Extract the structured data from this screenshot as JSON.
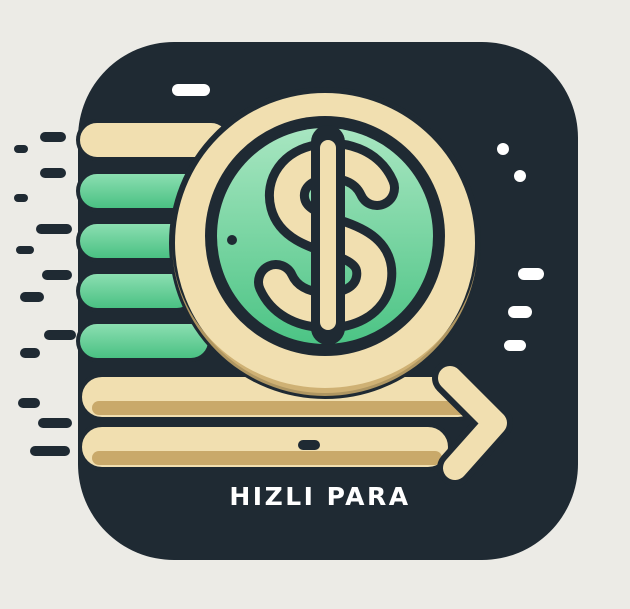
{
  "app": {
    "name": "HIZLI PARA",
    "icon": "dollar-coin-icon"
  },
  "colors": {
    "background": "#ecebe6",
    "tile": "#1f2a33",
    "cream": "#f1dfb0",
    "gold": "#c9a96a",
    "green": "#55c98a",
    "light_green": "#a8e6c1",
    "white": "#ffffff"
  }
}
